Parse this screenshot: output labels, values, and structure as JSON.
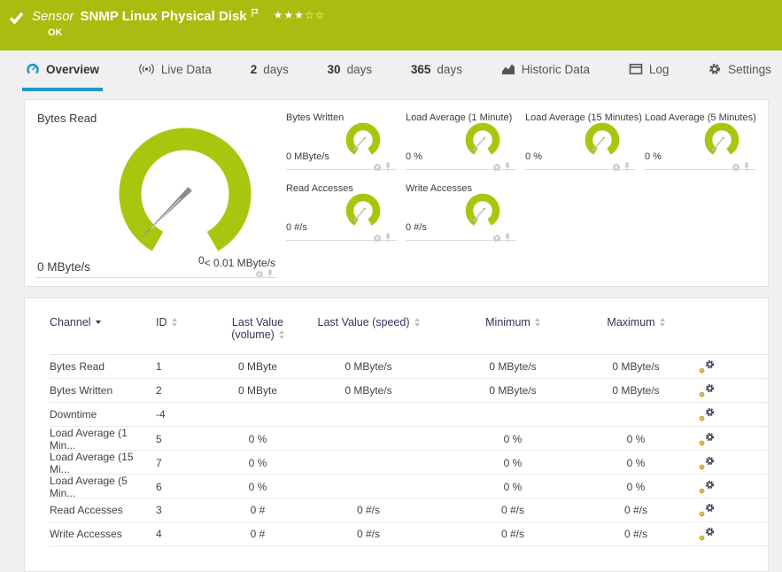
{
  "header": {
    "kind": "Sensor",
    "title": "SNMP Linux Physical Disk",
    "status": "OK",
    "stars_filled": "★★★",
    "stars_empty": "☆☆"
  },
  "tabs": {
    "overview": {
      "label": "Overview"
    },
    "live_data": {
      "label": "Live Data"
    },
    "days_2": {
      "num": "2",
      "unit": "days"
    },
    "days_30": {
      "num": "30",
      "unit": "days"
    },
    "days_365": {
      "num": "365",
      "unit": "days"
    },
    "historic_data": {
      "label": "Historic Data"
    },
    "log": {
      "label": "Log"
    },
    "settings": {
      "label": "Settings"
    }
  },
  "gauges": {
    "main": {
      "title": "Bytes Read",
      "value": "0 MByte/s",
      "scale_min": "0",
      "scale_max": "< 0.01 MByte/s"
    },
    "small": [
      {
        "title": "Bytes Written",
        "value": "0 MByte/s"
      },
      {
        "title": "Load Average (1 Minute)",
        "value": "0 %"
      },
      {
        "title": "Load Average (15 Minutes)",
        "value": "0 %"
      },
      {
        "title": "Load Average (5 Minutes)",
        "value": "0 %"
      },
      {
        "title": "Read Accesses",
        "value": "0 #/s"
      },
      {
        "title": "Write Accesses",
        "value": "0 #/s"
      }
    ]
  },
  "table": {
    "columns": {
      "channel": "Channel",
      "id": "ID",
      "volume_line1": "Last Value",
      "volume_line2": "(volume)",
      "speed": "Last Value (speed)",
      "min": "Minimum",
      "max": "Maximum"
    },
    "rows": [
      {
        "channel": "Bytes Read",
        "id": "1",
        "volume": "0 MByte",
        "speed": "0 MByte/s",
        "min": "0 MByte/s",
        "max": "0 MByte/s"
      },
      {
        "channel": "Bytes Written",
        "id": "2",
        "volume": "0 MByte",
        "speed": "0 MByte/s",
        "min": "0 MByte/s",
        "max": "0 MByte/s"
      },
      {
        "channel": "Downtime",
        "id": "-4",
        "volume": "",
        "speed": "",
        "min": "",
        "max": ""
      },
      {
        "channel": "Load Average (1 Min...",
        "id": "5",
        "volume": "0 %",
        "speed": "",
        "min": "0 %",
        "max": "0 %"
      },
      {
        "channel": "Load Average (15 Mi...",
        "id": "7",
        "volume": "0 %",
        "speed": "",
        "min": "0 %",
        "max": "0 %"
      },
      {
        "channel": "Load Average (5 Min...",
        "id": "6",
        "volume": "0 %",
        "speed": "",
        "min": "0 %",
        "max": "0 %"
      },
      {
        "channel": "Read Accesses",
        "id": "3",
        "volume": "0 #",
        "speed": "0 #/s",
        "min": "0 #/s",
        "max": "0 #/s"
      },
      {
        "channel": "Write Accesses",
        "id": "4",
        "volume": "0 #",
        "speed": "0 #/s",
        "min": "0 #/s",
        "max": "0 #/s"
      }
    ]
  },
  "colors": {
    "status_ok_green": "#a9bc0f",
    "gauge_green": "#a9c60f",
    "active_tab_blue": "#1e96c8",
    "table_header_navy": "#32325a"
  }
}
